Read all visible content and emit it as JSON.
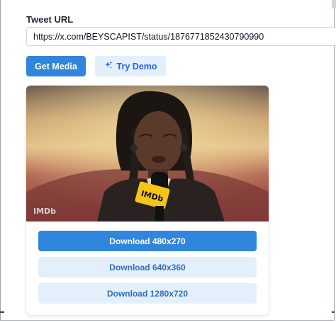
{
  "form": {
    "url_label": "Tweet URL",
    "url_value": "https://x.com/BEYSCAPIST/status/1876771852430790990",
    "get_media_label": "Get Media",
    "try_demo_label": "Try Demo"
  },
  "media": {
    "watermark": "IMDb",
    "mic_logo": "IMDb",
    "downloads": [
      {
        "label": "Download 480x270"
      },
      {
        "label": "Download 640x360"
      },
      {
        "label": "Download 1280x720"
      }
    ]
  },
  "colors": {
    "primary": "#2f86dc",
    "secondary_bg": "#e3effb",
    "imdb_yellow": "#f5c518"
  },
  "icons": {
    "try_demo": "sparkles-icon"
  }
}
